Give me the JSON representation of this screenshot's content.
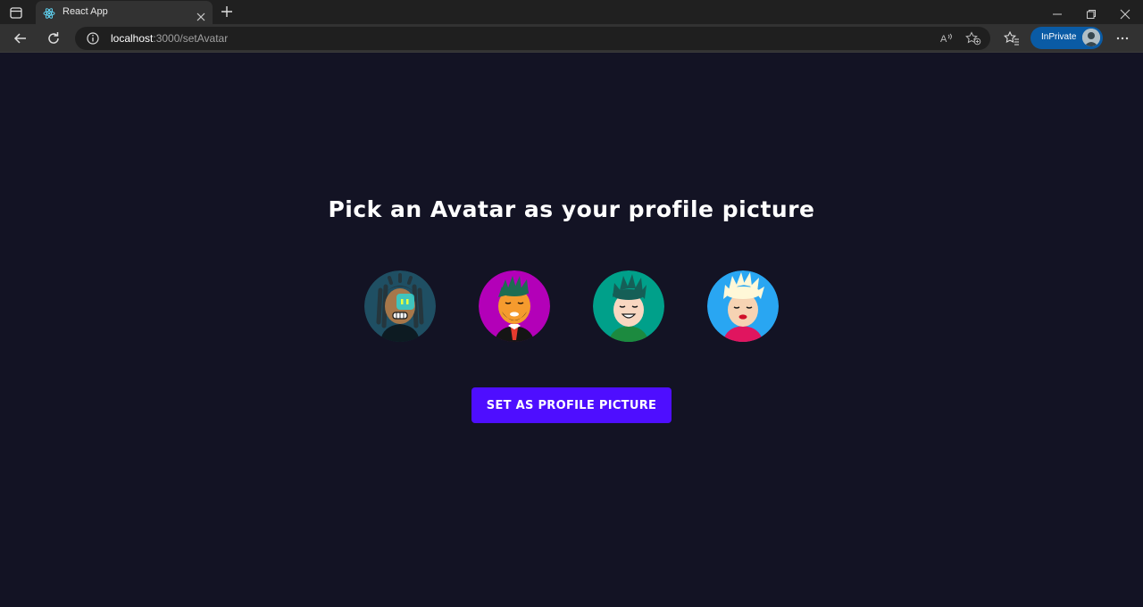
{
  "browser": {
    "tab_title": "React App",
    "url_host": "localhost",
    "url_path": ":3000/setAvatar",
    "inprivate_label": "InPrivate",
    "accent": "#0a5ba5",
    "tab_icon": "react-icon"
  },
  "page": {
    "heading": "Pick an Avatar as your profile picture",
    "button_label": "SET AS PROFILE PICTURE",
    "background": "#131324",
    "button_color": "#4e0eff",
    "avatars": [
      {
        "name": "avatar-option-1",
        "bg": "#1f4f63"
      },
      {
        "name": "avatar-option-2",
        "bg": "#b300b8"
      },
      {
        "name": "avatar-option-3",
        "bg": "#00a08a"
      },
      {
        "name": "avatar-option-4",
        "bg": "#29a6f2"
      }
    ]
  }
}
